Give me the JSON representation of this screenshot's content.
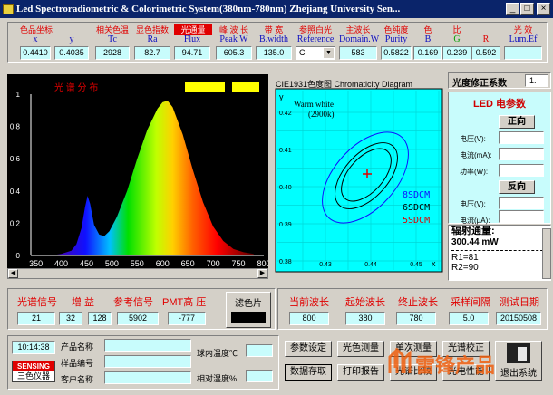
{
  "window": {
    "title": "Led Spectroradiometric & Colorimetric System(380nm-780nm)   Zhejiang University Sen...",
    "min": "_",
    "max": "□",
    "close": "×"
  },
  "params": [
    {
      "cn": "色品坐标",
      "en": "x",
      "val": "0.4410"
    },
    {
      "cn": "",
      "en": "y",
      "val": "0.4035"
    },
    {
      "cn": "相关色温",
      "en": "Tc",
      "val": "2928"
    },
    {
      "cn": "显色指数",
      "en": "Ra",
      "val": "82.7"
    },
    {
      "cn": "光通量",
      "en": "Flux",
      "val": "94.71"
    },
    {
      "cn": "峰 波 长",
      "en": "Peak W",
      "val": "605.3"
    },
    {
      "cn": "带  宽",
      "en": "B.width",
      "val": "135.0"
    },
    {
      "cn": "参照白光",
      "en": "Reference",
      "val": "C"
    },
    {
      "cn": "主波长",
      "en": "Domain.W",
      "val": "583"
    },
    {
      "cn": "色纯度",
      "en": "Purity",
      "val": "0.5822"
    },
    {
      "cn": "色",
      "en": "B",
      "val": "0.169"
    },
    {
      "cn": "比",
      "en": "G",
      "val": "0.239"
    },
    {
      "cn": "",
      "en": "R",
      "val": "0.592"
    },
    {
      "cn": "光 效",
      "en": "Lum.Ef",
      "val": ""
    }
  ],
  "spectrum": {
    "title": "光  谱  分  布",
    "xticks": [
      "350",
      "400",
      "450",
      "500",
      "550",
      "600",
      "650",
      "700",
      "750",
      "800"
    ],
    "yticks": [
      "1",
      "0.8",
      "0.6",
      "0.4",
      "0.2",
      "0"
    ]
  },
  "chromaticity": {
    "title": "CIE1931色度图  Chromaticity Diagram",
    "ylabel": "y",
    "xlabel": "x",
    "annotation": "Warm white",
    "annotation2": "(2900k)",
    "yticks": [
      "0.42",
      "0.41",
      "0.40",
      "0.39",
      "0.38"
    ],
    "xticks": [
      "0.43",
      "0.44",
      "0.45"
    ],
    "legend": [
      "8SDCM",
      "6SDCM",
      "5SDCM"
    ]
  },
  "led_params": {
    "correction_label": "光度修正系数",
    "correction_value": "1.",
    "title": "LED  电参数",
    "forward": "正向",
    "voltage": "电压(V):",
    "current_ma": "电流(mA):",
    "power": "功率(W):",
    "reverse": "反向",
    "rev_voltage": "电压(V):",
    "rev_current": "电流(μA):"
  },
  "radiant": {
    "label": "辐射通量:",
    "value": "300.44 mW",
    "r1": "R1=81",
    "r2": "R2=90"
  },
  "signals": {
    "spectral_label": "光谱信号",
    "gain_label": "增  益",
    "ref_label": "参考信号",
    "pmt_label": "PMT高 压",
    "filter_label": "滤色片",
    "spectral_val": "21",
    "gain_val1": "32",
    "gain_val2": "128",
    "ref_val": "5902",
    "pmt_val": "-777"
  },
  "wavelengths": {
    "current_label": "当前波长",
    "start_label": "起始波长",
    "end_label": "终止波长",
    "interval_label": "采样间隔",
    "date_label": "测试日期",
    "current_val": "800",
    "start_val": "380",
    "end_val": "780",
    "interval_val": "5.0",
    "date_val": "20150508"
  },
  "info": {
    "time": "10:14:38",
    "brand1": "SENSING",
    "brand2": "三色仪器",
    "product_name": "产品名称",
    "sample_no": "样品编号",
    "customer": "客户名称",
    "sphere_temp": "球内温度℃",
    "humidity": "相对湿度%"
  },
  "buttons": {
    "param_set": "参数设定",
    "color_measure": "光色测量",
    "single_measure": "单次测量",
    "spectral_calib": "光谱校正",
    "data_save": "数据存取",
    "print_report": "打印报告",
    "spectral_compare": "光谱比较",
    "color_char": "光电性能",
    "exit": "退出系统"
  },
  "watermark": "雷锋产品"
}
